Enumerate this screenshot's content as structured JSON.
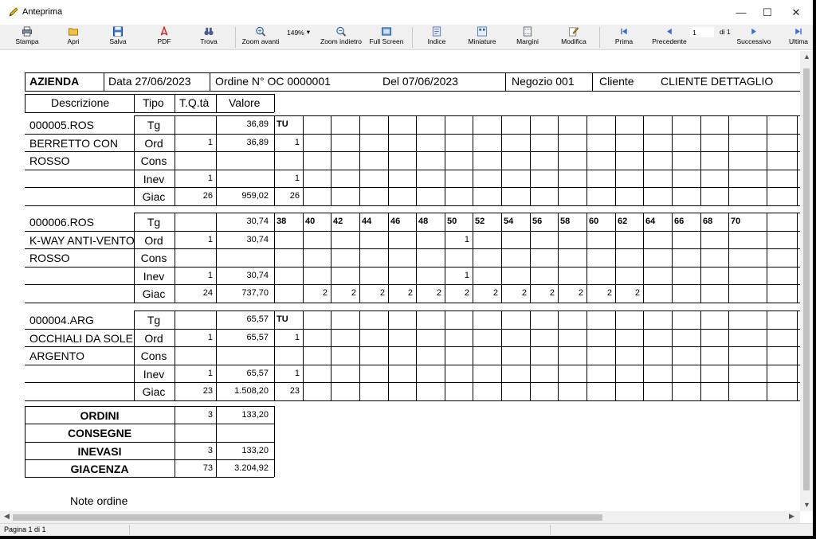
{
  "window": {
    "title": "Anteprima",
    "minimize": "—",
    "maximize": "☐",
    "close": "✕"
  },
  "toolbar": {
    "buttons": [
      {
        "label": "Stampa",
        "icon": "printer-icon"
      },
      {
        "label": "Apri",
        "icon": "folder-icon"
      },
      {
        "label": "Salva",
        "icon": "floppy-icon"
      },
      {
        "label": "PDF",
        "icon": "pdf-icon"
      },
      {
        "label": "Trova",
        "icon": "binoculars-icon"
      },
      {
        "label": "Zoom avanti",
        "icon": "zoom-in-icon"
      },
      {
        "label": "Zoom indietro",
        "icon": "zoom-out-icon"
      },
      {
        "label": "Full Screen",
        "icon": "fullscreen-icon"
      },
      {
        "label": "Indice",
        "icon": "index-icon"
      },
      {
        "label": "Miniature",
        "icon": "thumbnails-icon"
      },
      {
        "label": "Margini",
        "icon": "margins-icon"
      },
      {
        "label": "Modifica",
        "icon": "edit-icon"
      },
      {
        "label": "Prima",
        "icon": "first-page-icon"
      },
      {
        "label": "Precedente",
        "icon": "previous-page-icon"
      },
      {
        "label": "Successivo",
        "icon": "next-page-icon"
      },
      {
        "label": "Ultima",
        "icon": "last-page-icon"
      }
    ],
    "zoom": "149%",
    "page_current": "1",
    "page_of": "di 1"
  },
  "header": {
    "azienda": "AZIENDA",
    "data": "Data 27/06/2023",
    "ordine": "Ordine N°  OC    0000001",
    "del": "Del  07/06/2023",
    "negozio": "Negozio   001",
    "cliente_label": "Cliente",
    "cliente_value": "CLIENTE DETTAGLIO"
  },
  "columns": {
    "descrizione": "Descrizione",
    "tipo": "Tipo",
    "tqta": "T.Q.tà",
    "valore": "Valore"
  },
  "blocks": [
    {
      "desc": [
        "000005.ROS",
        "BERRETTO CON",
        "ROSSO",
        ""
      ],
      "rows": [
        {
          "tipo": "Tg",
          "qty": "",
          "val": "36,89",
          "sizes": [
            "TU"
          ]
        },
        {
          "tipo": "Ord",
          "qty": "1",
          "val": "36,89",
          "sizes": [
            "1"
          ]
        },
        {
          "tipo": "Cons",
          "qty": "",
          "val": "",
          "sizes": []
        },
        {
          "tipo": "Inev",
          "qty": "1",
          "val": "",
          "sizes": [
            "1"
          ]
        },
        {
          "tipo": "Giac",
          "qty": "26",
          "val": "959,02",
          "sizes": [
            "26"
          ]
        }
      ]
    },
    {
      "desc": [
        "000006.ROS",
        "K-WAY ANTI-VENTO",
        "ROSSO",
        ""
      ],
      "rows": [
        {
          "tipo": "Tg",
          "qty": "",
          "val": "30,74",
          "sizes": [
            "38",
            "40",
            "42",
            "44",
            "46",
            "48",
            "50",
            "52",
            "54",
            "56",
            "58",
            "60",
            "62",
            "64",
            "66",
            "68",
            "70"
          ]
        },
        {
          "tipo": "Ord",
          "qty": "1",
          "val": "30,74",
          "sizes": [
            "",
            "",
            "",
            "",
            "",
            "",
            "1"
          ]
        },
        {
          "tipo": "Cons",
          "qty": "",
          "val": "",
          "sizes": []
        },
        {
          "tipo": "Inev",
          "qty": "1",
          "val": "30,74",
          "sizes": [
            "",
            "",
            "",
            "",
            "",
            "",
            "1"
          ]
        },
        {
          "tipo": "Giac",
          "qty": "24",
          "val": "737,70",
          "sizes": [
            "",
            "2",
            "2",
            "2",
            "2",
            "2",
            "2",
            "2",
            "2",
            "2",
            "2",
            "2",
            "2"
          ]
        }
      ]
    },
    {
      "desc": [
        "000004.ARG",
        "OCCHIALI DA SOLE",
        "ARGENTO",
        ""
      ],
      "rows": [
        {
          "tipo": "Tg",
          "qty": "",
          "val": "65,57",
          "sizes": [
            "TU"
          ]
        },
        {
          "tipo": "Ord",
          "qty": "1",
          "val": "65,57",
          "sizes": [
            "1"
          ]
        },
        {
          "tipo": "Cons",
          "qty": "",
          "val": "",
          "sizes": []
        },
        {
          "tipo": "Inev",
          "qty": "1",
          "val": "65,57",
          "sizes": [
            "1"
          ]
        },
        {
          "tipo": "Giac",
          "qty": "23",
          "val": "1.508,20",
          "sizes": [
            "23"
          ]
        }
      ]
    }
  ],
  "totals": [
    {
      "label": "ORDINI",
      "qty": "3",
      "val": "133,20"
    },
    {
      "label": "CONSEGNE",
      "qty": "",
      "val": ""
    },
    {
      "label": "INEVASI",
      "qty": "3",
      "val": "133,20"
    },
    {
      "label": "GIACENZA",
      "qty": "73",
      "val": "3.204,92"
    }
  ],
  "note": "Note ordine",
  "status": {
    "page": "Pagina 1 di 1"
  }
}
